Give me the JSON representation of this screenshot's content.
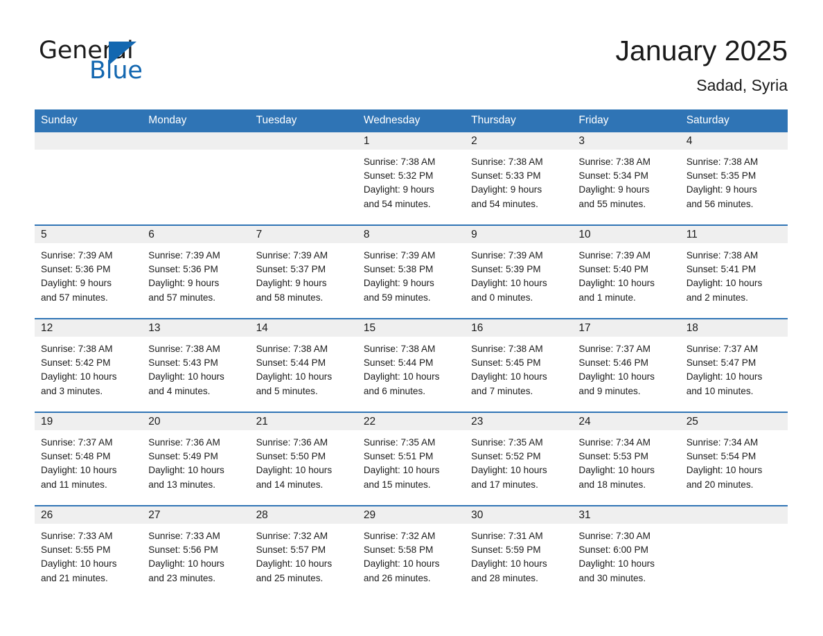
{
  "logo": {
    "word_one": "General",
    "word_two": "Blue",
    "flag_icon": "triangle-flag-icon",
    "accent_color": "#1367b0"
  },
  "header": {
    "title": "January 2025",
    "subtitle": "Sadad, Syria"
  },
  "theme": {
    "header_blue": "#2f74b5",
    "daynum_gray": "#efefef",
    "text": "#1a1a1a"
  },
  "calendar": {
    "weekday_headers": [
      "Sunday",
      "Monday",
      "Tuesday",
      "Wednesday",
      "Thursday",
      "Friday",
      "Saturday"
    ],
    "weeks": [
      [
        {
          "day": "",
          "lines": []
        },
        {
          "day": "",
          "lines": []
        },
        {
          "day": "",
          "lines": []
        },
        {
          "day": "1",
          "lines": [
            "Sunrise: 7:38 AM",
            "Sunset: 5:32 PM",
            "Daylight: 9 hours",
            "and 54 minutes."
          ]
        },
        {
          "day": "2",
          "lines": [
            "Sunrise: 7:38 AM",
            "Sunset: 5:33 PM",
            "Daylight: 9 hours",
            "and 54 minutes."
          ]
        },
        {
          "day": "3",
          "lines": [
            "Sunrise: 7:38 AM",
            "Sunset: 5:34 PM",
            "Daylight: 9 hours",
            "and 55 minutes."
          ]
        },
        {
          "day": "4",
          "lines": [
            "Sunrise: 7:38 AM",
            "Sunset: 5:35 PM",
            "Daylight: 9 hours",
            "and 56 minutes."
          ]
        }
      ],
      [
        {
          "day": "5",
          "lines": [
            "Sunrise: 7:39 AM",
            "Sunset: 5:36 PM",
            "Daylight: 9 hours",
            "and 57 minutes."
          ]
        },
        {
          "day": "6",
          "lines": [
            "Sunrise: 7:39 AM",
            "Sunset: 5:36 PM",
            "Daylight: 9 hours",
            "and 57 minutes."
          ]
        },
        {
          "day": "7",
          "lines": [
            "Sunrise: 7:39 AM",
            "Sunset: 5:37 PM",
            "Daylight: 9 hours",
            "and 58 minutes."
          ]
        },
        {
          "day": "8",
          "lines": [
            "Sunrise: 7:39 AM",
            "Sunset: 5:38 PM",
            "Daylight: 9 hours",
            "and 59 minutes."
          ]
        },
        {
          "day": "9",
          "lines": [
            "Sunrise: 7:39 AM",
            "Sunset: 5:39 PM",
            "Daylight: 10 hours",
            "and 0 minutes."
          ]
        },
        {
          "day": "10",
          "lines": [
            "Sunrise: 7:39 AM",
            "Sunset: 5:40 PM",
            "Daylight: 10 hours",
            "and 1 minute."
          ]
        },
        {
          "day": "11",
          "lines": [
            "Sunrise: 7:38 AM",
            "Sunset: 5:41 PM",
            "Daylight: 10 hours",
            "and 2 minutes."
          ]
        }
      ],
      [
        {
          "day": "12",
          "lines": [
            "Sunrise: 7:38 AM",
            "Sunset: 5:42 PM",
            "Daylight: 10 hours",
            "and 3 minutes."
          ]
        },
        {
          "day": "13",
          "lines": [
            "Sunrise: 7:38 AM",
            "Sunset: 5:43 PM",
            "Daylight: 10 hours",
            "and 4 minutes."
          ]
        },
        {
          "day": "14",
          "lines": [
            "Sunrise: 7:38 AM",
            "Sunset: 5:44 PM",
            "Daylight: 10 hours",
            "and 5 minutes."
          ]
        },
        {
          "day": "15",
          "lines": [
            "Sunrise: 7:38 AM",
            "Sunset: 5:44 PM",
            "Daylight: 10 hours",
            "and 6 minutes."
          ]
        },
        {
          "day": "16",
          "lines": [
            "Sunrise: 7:38 AM",
            "Sunset: 5:45 PM",
            "Daylight: 10 hours",
            "and 7 minutes."
          ]
        },
        {
          "day": "17",
          "lines": [
            "Sunrise: 7:37 AM",
            "Sunset: 5:46 PM",
            "Daylight: 10 hours",
            "and 9 minutes."
          ]
        },
        {
          "day": "18",
          "lines": [
            "Sunrise: 7:37 AM",
            "Sunset: 5:47 PM",
            "Daylight: 10 hours",
            "and 10 minutes."
          ]
        }
      ],
      [
        {
          "day": "19",
          "lines": [
            "Sunrise: 7:37 AM",
            "Sunset: 5:48 PM",
            "Daylight: 10 hours",
            "and 11 minutes."
          ]
        },
        {
          "day": "20",
          "lines": [
            "Sunrise: 7:36 AM",
            "Sunset: 5:49 PM",
            "Daylight: 10 hours",
            "and 13 minutes."
          ]
        },
        {
          "day": "21",
          "lines": [
            "Sunrise: 7:36 AM",
            "Sunset: 5:50 PM",
            "Daylight: 10 hours",
            "and 14 minutes."
          ]
        },
        {
          "day": "22",
          "lines": [
            "Sunrise: 7:35 AM",
            "Sunset: 5:51 PM",
            "Daylight: 10 hours",
            "and 15 minutes."
          ]
        },
        {
          "day": "23",
          "lines": [
            "Sunrise: 7:35 AM",
            "Sunset: 5:52 PM",
            "Daylight: 10 hours",
            "and 17 minutes."
          ]
        },
        {
          "day": "24",
          "lines": [
            "Sunrise: 7:34 AM",
            "Sunset: 5:53 PM",
            "Daylight: 10 hours",
            "and 18 minutes."
          ]
        },
        {
          "day": "25",
          "lines": [
            "Sunrise: 7:34 AM",
            "Sunset: 5:54 PM",
            "Daylight: 10 hours",
            "and 20 minutes."
          ]
        }
      ],
      [
        {
          "day": "26",
          "lines": [
            "Sunrise: 7:33 AM",
            "Sunset: 5:55 PM",
            "Daylight: 10 hours",
            "and 21 minutes."
          ]
        },
        {
          "day": "27",
          "lines": [
            "Sunrise: 7:33 AM",
            "Sunset: 5:56 PM",
            "Daylight: 10 hours",
            "and 23 minutes."
          ]
        },
        {
          "day": "28",
          "lines": [
            "Sunrise: 7:32 AM",
            "Sunset: 5:57 PM",
            "Daylight: 10 hours",
            "and 25 minutes."
          ]
        },
        {
          "day": "29",
          "lines": [
            "Sunrise: 7:32 AM",
            "Sunset: 5:58 PM",
            "Daylight: 10 hours",
            "and 26 minutes."
          ]
        },
        {
          "day": "30",
          "lines": [
            "Sunrise: 7:31 AM",
            "Sunset: 5:59 PM",
            "Daylight: 10 hours",
            "and 28 minutes."
          ]
        },
        {
          "day": "31",
          "lines": [
            "Sunrise: 7:30 AM",
            "Sunset: 6:00 PM",
            "Daylight: 10 hours",
            "and 30 minutes."
          ]
        },
        {
          "day": "",
          "lines": []
        }
      ]
    ]
  }
}
